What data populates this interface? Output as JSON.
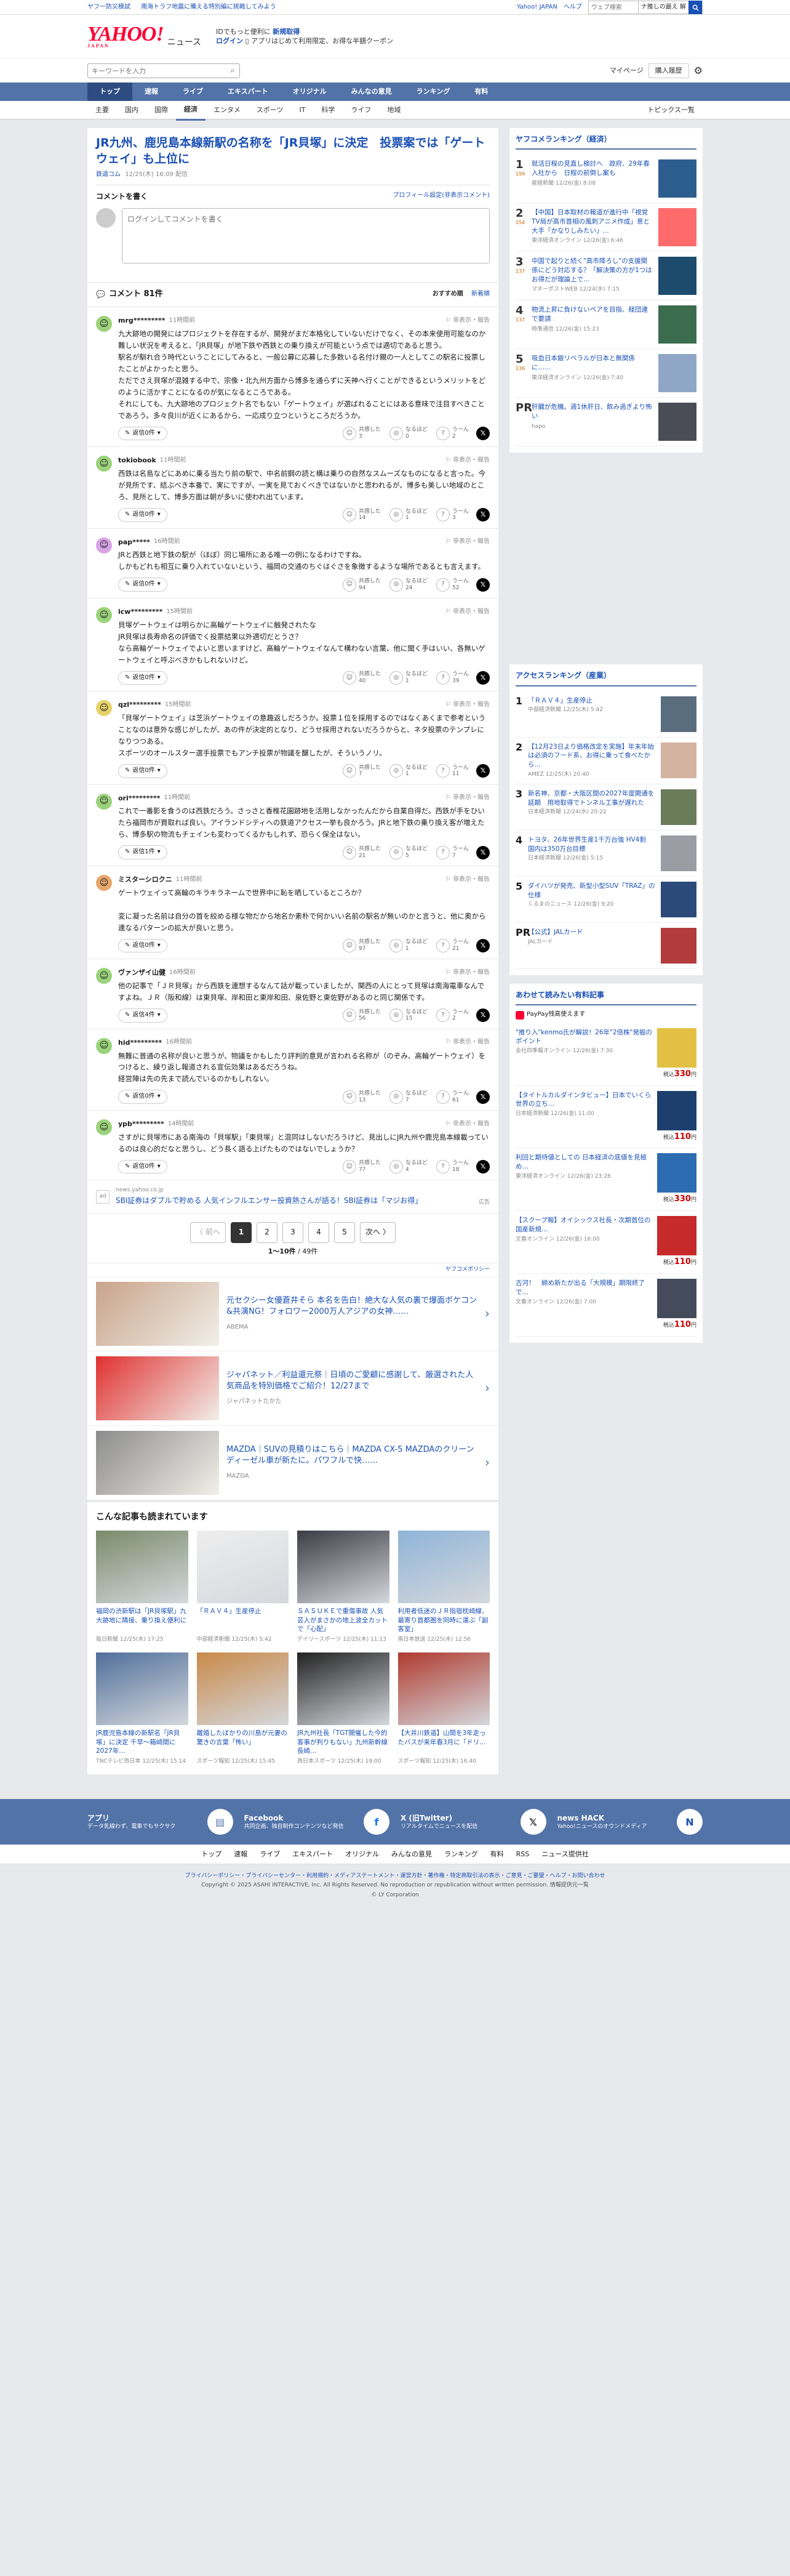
{
  "util": {
    "left": [
      "ヤフー防災模試",
      "南海トラフ地震に備える特別編に挑戦してみよう"
    ],
    "right": [
      "Yahoo! JAPAN",
      "ヘルプ"
    ],
    "search_placeholder": "ウェブ検索",
    "search_scope": "ナ推しの最え 解"
  },
  "header": {
    "logo": "YAHOO!",
    "logo_sub": "JAPAN",
    "service": "ニュース",
    "promo1": "IDでもっと便利に",
    "promo1_link": "新規取得",
    "promo2_a": "ログイン",
    "promo2_b": "アプリはじめて利用限定、お得な半額クーポン"
  },
  "keyword_search": {
    "placeholder": "キーワードを入力",
    "mypage": "マイページ",
    "history": "購入履歴"
  },
  "nav_main": [
    "トップ",
    "速報",
    "ライブ",
    "エキスパート",
    "オリジナル",
    "みんなの意見",
    "ランキング",
    "有料"
  ],
  "nav_sub": [
    "主要",
    "国内",
    "国際",
    "経済",
    "エンタメ",
    "スポーツ",
    "IT",
    "科学",
    "ライフ",
    "地域"
  ],
  "nav_sub_active": "経済",
  "nav_sub_right": "トピックス一覧",
  "article": {
    "title": "JR九州、鹿児島本線新駅の名称を「JR貝塚」に決定　投票案では「ゲートウェイ」も上位に",
    "source": "鉄道コム",
    "date": "12/25(木) 16:09",
    "date_suffix": "配信"
  },
  "comment_write": {
    "title": "コメントを書く",
    "profile_link": "プロフィール設定(非表示コメント)",
    "placeholder": "ログインしてコメントを書く"
  },
  "comments_header": {
    "count_label": "コメント 81件",
    "sort_recommended": "おすすめ順",
    "sort_newest": "新着順"
  },
  "reaction_labels": {
    "agree": "共感した",
    "insight": "なるほど",
    "hmm": "うーん"
  },
  "reply_prefix": "返信",
  "report_label": "非表示・報告",
  "comments": [
    {
      "user": "mrg*********",
      "time": "11時間前",
      "color": "#9bd37c",
      "text": "九大跡地の開発にはプロジェクトを存在するが、開発がまだ本格化していないだけでなく、その本来使用可能なのか難しい状況を考えると、「JR貝塚」が地下鉄や西鉄との乗り換えが可能という点では適切であると思う。\n駅名が馴れ合う時代ということにしてみると、一般公募に応募した多数いる名付け親の一人としてこの駅名に投票したことがよかったと思う。\nただでさえ貝塚が混雑する中で、宗像・北九州方面から博多を通らずに天神へ行くことができるというメリットをどのように活かすことになるのが気になるところである。\nそれにしても、九大跡地のプロジェクト名でもない「ゲートウェイ」が選ばれることにはある意味で注目すべきことであろう。多々良川が近くにあるから、一応成り立つというところだろうか。",
      "replies": "返信0件",
      "agree": "3",
      "insight": "0",
      "hmm": "2"
    },
    {
      "user": "tokiobook",
      "time": "11時間前",
      "color": "#9bd37c",
      "text": "西鉄は名島などにあめに乗る当たり前の駅で、中名前鋼の読と構は乗りの自然なスムーズなものになると言った。今が見所です、結ぶべき本番で、実にですが、一実を見ておくべきではないかと思われるが、博多も美しい地域のところ、見所として、博多方面は朝が多いに使われ出ています。",
      "replies": "返信0件",
      "agree": "14",
      "insight": "1",
      "hmm": "3"
    },
    {
      "user": "pap*****",
      "time": "16時間前",
      "color": "#d9a3e6",
      "text": "JRと西鉄と地下鉄の駅が（ほぼ）同じ場所にある唯一の例になるわけですね。\nしかもどれも相互に乗り入れていないという、福岡の交通のちぐはぐさを象徴するような場所であるとも言えます。",
      "replies": "返信0件",
      "agree": "94",
      "insight": "24",
      "hmm": "52"
    },
    {
      "user": "icw*********",
      "time": "15時間前",
      "color": "#9bd37c",
      "text": "貝塚ゲートウェイは明らかに高輪ゲートウェイに触発されたな\nJR貝塚は長寿命名の評価でく投票結果以外適切だとうさ？\nなら高輪ゲートウェイでよいと思いますけど、高輪ゲートウェイなんて構わない言葉、他に聞く手はいい、各無いゲートウェイと呼ぶべきかもしれないけど。",
      "replies": "返信0件",
      "agree": "40",
      "insight": "1",
      "hmm": "39"
    },
    {
      "user": "qzl*********",
      "time": "15時間前",
      "color": "#e6d26b",
      "text": "「貝塚ゲートウェイ」は芝浜ゲートウェイの意趣返しだろうか。投票１位を採用するのではなくあくまで参考ということなのは意外な感じがしたが、あの件が決定的となり、どうせ採用されないだろうからと、ネタ投票のテンプレになりつつある。\nスポーツのオールスター選手投票でもアンチ投票が物議を醸したが、そういうノリ。",
      "replies": "返信0件",
      "agree": "7",
      "insight": "1",
      "hmm": "11"
    },
    {
      "user": "ori*********",
      "time": "11時間前",
      "color": "#9bd37c",
      "text": "これで一番影を食うのは西鉄だろう。さっさと香椎花園跡地を活用しなかったんだから自業自得だ。西鉄が手をひいたら福岡市が買取れば良い。アイランドシティへの鉄道アクセス一挙も良かろう。JRと地下鉄の乗り換え客が増えたら、博多駅の物流もチェインも変わってくるかもしれず、恐らく保全はない。",
      "replies": "返信1件",
      "agree": "21",
      "insight": "5",
      "hmm": "7"
    },
    {
      "user": "ミスターシロクニ",
      "time": "11時間前",
      "color": "#e6a86b",
      "text": "ゲートウェイって高輪のキラキラネームで世界中に恥を晒しているところか？\n\n変に凝った名前は自分の首を絞める様な物だから地名か素朴で何かいい名前の駅名が無いのかと言うと、他に奥から連なるパターンの拡大が良いと思う。",
      "replies": "返信0件",
      "agree": "97",
      "insight": "1",
      "hmm": "21"
    },
    {
      "user": "ヴァンザイ山健",
      "time": "16時間前",
      "color": "#9bd37c",
      "text": "他の記事で「ＪＲ貝塚」から西鉄を連想するなんて話が載っていましたが、関西の人にとって貝塚は南海電車なんですよね。ＪＲ（阪和線）は東貝塚、岸和田と東岸和田、泉佐野と東佐野があるのと同じ関係です。",
      "replies": "返信4件",
      "agree": "56",
      "insight": "15",
      "hmm": "2"
    },
    {
      "user": "hid*********",
      "time": "16時間前",
      "color": "#9bd37c",
      "text": "無難に普通の名称が良いと思うが、物議をかもしたり評判的意見が言われる名称が（のぞみ、高輪ゲートウェイ）をつけると、繰り返し報道される宣伝効果はあるだろうね。\n経営陣は先の先まで読んでいるのかもしれない。",
      "replies": "返信0件",
      "agree": "13",
      "insight": "7",
      "hmm": "61"
    },
    {
      "user": "ypb*********",
      "time": "14時間前",
      "color": "#9bd37c",
      "text": "さすがに貝塚市にある南海の「貝塚駅」「東貝塚」と混同はしないだろうけど、見出しにJR九州や鹿児島本線載っているのは良心的だなと思うし、どう長く語る上げたものではないでしょうか？",
      "replies": "返信0件",
      "agree": "77",
      "insight": "4",
      "hmm": "18"
    }
  ],
  "ad_inline": {
    "source": "news.yahoo.co.jp",
    "title": "SBI証券はダブルで貯める 人気インフルエンサー投資熱さんが語る！SBI証券は「マジお得」",
    "label": "広告"
  },
  "pager": {
    "prev": "〈 前へ",
    "pages": [
      "1",
      "2",
      "3",
      "4",
      "5"
    ],
    "next": "次へ 〉",
    "count": "1〜10件",
    "total": "49件"
  },
  "sponsor_label": "ヤフコメポリシー",
  "ads": [
    {
      "title": "元セクシー女優蒼井そら 本名を告白！絶大な人気の裏で爆面ボケコン&共演NG！フォロワー2000万人アジアの女神……",
      "source": "ABEMA"
    },
    {
      "title": "ジャパネット／利益還元祭｜日頃のご愛顧に感謝して、厳選された人気商品を特別価格でご紹介！12/27まで",
      "source": "ジャパネットたかた"
    },
    {
      "title": "MAZDA｜SUVの見積りはこちら｜MAZDA CX-5 MAZDAのクリーンディーゼル車が新たに。パワフルで快……",
      "source": "MAZDA"
    }
  ],
  "also_read": {
    "title": "こんな記事も読まれています",
    "items": [
      {
        "title": "福岡の渋新駅は「JR貝塚駅」九大跡地に隣接、乗り換え便利に",
        "source": "毎日新聞",
        "time": "12/25(木) 17:25"
      },
      {
        "title": "「ＲＡＶ４」生産停止",
        "source": "中部経済新聞",
        "time": "12/25(木) 5:42"
      },
      {
        "title": "ＳＡＳＵＫＥで重傷事故 人気芸人がまさかの地上波全カットで「心配」",
        "source": "デイリースポーツ",
        "time": "12/25(木) 11:13"
      },
      {
        "title": "利用者低迷のＪＲ指宿枕崎線、最寄り首都圏を同時に運ぶ「副客室」",
        "source": "南日本放送",
        "time": "12/25(木) 12:56"
      },
      {
        "title": "JR鹿児島本線の新駅名「JR貝塚」に決定 千早〜箱崎間に2027年…",
        "source": "TNCテレビ西日本",
        "time": "12/25(木) 15:14"
      },
      {
        "title": "離婚したばかりの川島が元妻の驚きの言葉「怖い」",
        "source": "スポーツ報知",
        "time": "12/25(木) 15:45"
      },
      {
        "title": "JR九州社長「TGT開催した今的客事が判りもない」九州新幹線長崎…",
        "source": "西日本スポーツ",
        "time": "12/25(木) 19:00"
      },
      {
        "title": "【大井川鉄道】山間を3年走ったバスが来年春3月に「ドリ…",
        "source": "スポーツ報知",
        "time": "12/25(木) 16:40"
      }
    ]
  },
  "ranking": {
    "title": "ヤフコメランキング（経済）",
    "items": [
      {
        "rank": "1",
        "count": "199",
        "title": "就活日程の見直し検討へ　政府、29年春入社から　日程の前倒し案も",
        "source": "産経新聞",
        "time": "12/26(金) 8:08"
      },
      {
        "rank": "2",
        "count": "154",
        "title": "【中国】日本取材の報道が進行中「視覚TV局が高市首相の風刺アニメ作成」意と大手「かなりしみたい」…",
        "source": "東洋経済オンライン",
        "time": "12/26(金) 6:46"
      },
      {
        "rank": "3",
        "count": "137",
        "title": "中国で起りと続く\"高市降ろし\"の支援関係にどう対応する？「解決策の方が1つはお得だが理論上で…",
        "source": "マネーポストWEB",
        "time": "12/24(水) 7:15"
      },
      {
        "rank": "4",
        "count": "137",
        "title": "物流上昇に負けないペアを目指、経団連で要請",
        "source": "時事通信",
        "time": "12/26(金) 15:23"
      },
      {
        "rank": "5",
        "count": "136",
        "title": "吸血日本銀リベラルが日本と無関係に……",
        "source": "東洋経済オンライン",
        "time": "12/26(金) 7:40"
      },
      {
        "rank": "PR",
        "count": "",
        "title": "肝臓が危機。週1休肝日、飲み過ぎより怖い",
        "source": "hapo",
        "time": ""
      }
    ]
  },
  "access_ranking": {
    "title": "アクセスランキング（産業）",
    "items": [
      {
        "rank": "1",
        "title": "「ＲＡＶ４」生産停止",
        "source": "中部経済新聞",
        "time": "12/25(木) 5:42"
      },
      {
        "rank": "2",
        "title": "【12月23日より価格改定を実施】年末年始は必須のフード系、お得に乗って食べたから…",
        "source": "AMEZ",
        "time": "12/25(木) 20:40"
      },
      {
        "rank": "3",
        "title": "新名神、京都・大阪区間の2027年度開通を延期　用地取得でトンネル工事が遅れた",
        "source": "日本経済新聞",
        "time": "12/24(水) 20:22"
      },
      {
        "rank": "4",
        "title": "トヨタ、26年世界生産1千万台強 HV4割　国内は350万台目標",
        "source": "日本経済新聞",
        "time": "12/26(金) 5:15"
      },
      {
        "rank": "5",
        "title": "ダイハツが発売、新型小型SUV「TRAZ」の仕様",
        "source": "くるまのニュース",
        "time": "12/26(金) 9:20"
      },
      {
        "rank": "PR",
        "title": "【公式】JALカード",
        "source": "JALカード",
        "time": ""
      }
    ]
  },
  "paid": {
    "title": "あわせて読みたい有料記事",
    "paypay": "PayPay残高使えます",
    "items": [
      {
        "title": "\"推り入\"kenmo氏が解説！26年\"2倍株\"発掘のポイント",
        "source": "会社四季報オンライン",
        "time": "12/26(金) 7:30",
        "price": "330"
      },
      {
        "title": "【タイトルカルダインタビュー】日本でいくら世界の立ち…",
        "source": "日本経済新聞",
        "time": "12/26(金) 11:00",
        "price": "110"
      },
      {
        "title": "利回と期待値としての 日本経済の底値を見極め…",
        "source": "東洋経済オンライン",
        "time": "12/26(金) 23:28",
        "price": "330"
      },
      {
        "title": "【スクープ報】オイシックス社長・次期首位の国産新規…",
        "source": "文春オンライン",
        "time": "12/26(金) 16:00",
        "price": "110"
      },
      {
        "title": "古河！　締め新たが出る「大規模」期限終了で…",
        "source": "文春オンライン",
        "time": "12/26(金) 7:00",
        "price": "110"
      }
    ]
  },
  "price_suffix": "円",
  "price_prefix": "税込",
  "footer_apps": [
    {
      "title": "アプリ",
      "desc": "データ乳線わず、電車でもサクサク"
    },
    {
      "title": "Facebook",
      "desc": "共同企画、独自制作コンテンツなど発信"
    },
    {
      "title": "X (旧Twitter)",
      "desc": "リアルタイムでニュースを配信"
    },
    {
      "title": "news HACK",
      "desc": "Yahoo!ニュースのオウンドメディア"
    }
  ],
  "footer_nav": [
    "トップ",
    "速報",
    "ライブ",
    "エキスパート",
    "オリジナル",
    "みんなの意見",
    "ランキング",
    "有料",
    "RSS",
    "ニュース提供社"
  ],
  "footer_links": "プライバシーポリシー・プライバシーセンター・利用規約・メディアステートメント・運営方針・著作権・特定商取引法の表示・ご意見・ご要望・ヘルプ・お問い合わせ",
  "copyright": "Copyright © 2025 ASAHI INTERACTIVE, Inc. All Rights Reserved. No reproduction or republication without written permission. 情報提供元一覧",
  "ly": "© LY Corporation"
}
